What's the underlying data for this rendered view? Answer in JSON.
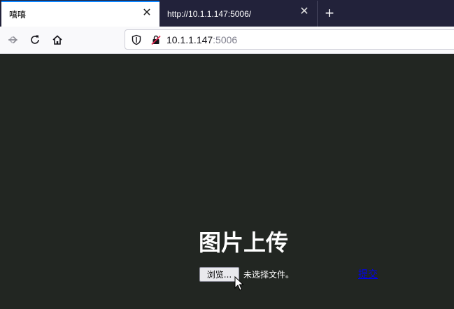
{
  "tabs": [
    {
      "title": "嘻嘻",
      "active": true
    },
    {
      "title": "http://10.1.1.147:5006/",
      "active": false
    }
  ],
  "tab_close_glyph": "✕",
  "new_tab_glyph": "+",
  "urlbar": {
    "host": "10.1.1.147",
    "port": ":5006"
  },
  "page": {
    "heading": "图片上传",
    "browse_button": "浏览...",
    "file_status": "未选择文件。",
    "submit_link": "提交"
  },
  "colors": {
    "tab_strip": "#22223a",
    "active_tab_accent": "#0a84ff",
    "page_background": "#222622",
    "link": "#0000ee"
  },
  "icons": [
    "back-arrow-icon",
    "forward-arrow-icon",
    "reload-icon",
    "home-icon",
    "shield-icon",
    "insecure-lock-icon",
    "close-icon",
    "plus-icon",
    "mouse-cursor-icon"
  ]
}
